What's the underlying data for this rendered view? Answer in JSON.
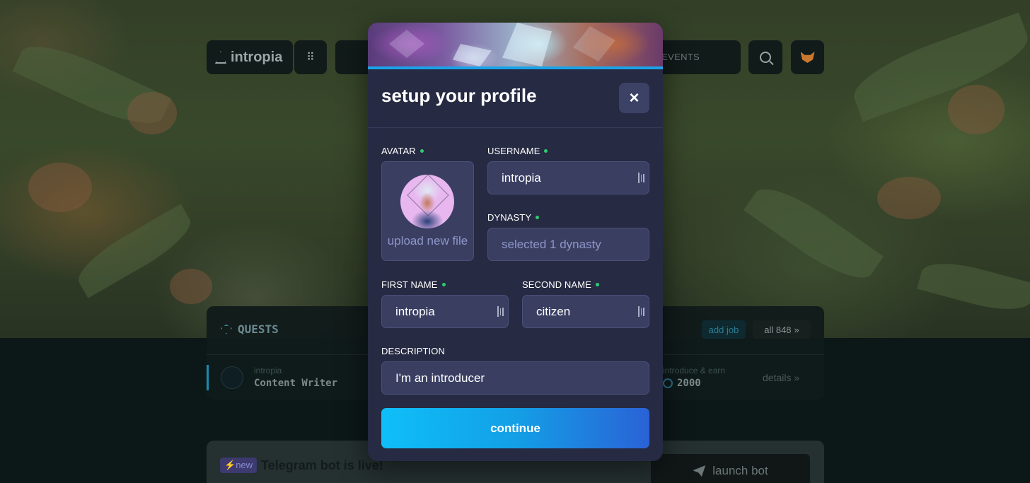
{
  "nav": {
    "brand": "intropia",
    "events_label": "EVENTS"
  },
  "quests": {
    "title": "QUESTS",
    "add_job_label": "add job",
    "all_label": "all 848",
    "row": {
      "org": "intropia",
      "job": "Content Writer",
      "reward_label": "introduce & earn",
      "reward_value": "2000",
      "details_label": "details"
    }
  },
  "telegram": {
    "badge": "new",
    "title": "Telegram bot is live!",
    "launch_label": "launch bot"
  },
  "modal": {
    "title": "setup your profile",
    "close_glyph": "×",
    "avatar": {
      "label": "AVATAR",
      "upload_label": "upload new file"
    },
    "username": {
      "label": "USERNAME",
      "value": "intropia"
    },
    "dynasty": {
      "label": "DYNASTY",
      "placeholder": "selected 1 dynasty"
    },
    "first_name": {
      "label": "FIRST NAME",
      "value": "intropia"
    },
    "second_name": {
      "label": "SECOND NAME",
      "value": "citizen"
    },
    "description": {
      "label": "DESCRIPTION",
      "value": "I'm an introducer"
    },
    "continue_label": "continue"
  },
  "colors": {
    "modal_bg": "#262a42",
    "field_bg": "#3a3f62",
    "required_dot": "#2ecc71",
    "accent_line": "#1aa3e8",
    "button_gradient_start": "#0fbff8",
    "button_gradient_end": "#2a62d6"
  },
  "icons": [
    "intropia-logo-icon",
    "grid-icon",
    "search-icon",
    "metamask-fox-icon",
    "close-icon",
    "password-manager-icon",
    "chevrons-right-icon",
    "telegram-icon",
    "lightning-icon"
  ]
}
